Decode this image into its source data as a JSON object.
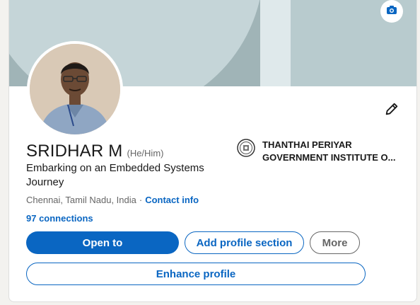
{
  "profile": {
    "name": "SRIDHAR M",
    "pronouns": "(He/Him)",
    "headline": "Embarking on an Embedded Systems Journey",
    "location": "Chennai, Tamil Nadu, India",
    "separator": "·",
    "contact_info": "Contact info",
    "connections": "97 connections"
  },
  "education": {
    "line1": "THANTHAI PERIYAR",
    "line2": "GOVERNMENT INSTITUTE O..."
  },
  "actions": {
    "open_to": "Open to",
    "add_section": "Add profile section",
    "more": "More",
    "enhance": "Enhance profile"
  },
  "icons": {
    "camera": "camera-icon",
    "edit": "pencil-icon",
    "school_logo": "school-seal-icon"
  },
  "colors": {
    "accent": "#0a66c2",
    "cover": "#a0b4b7",
    "text": "#191919",
    "muted": "#666666"
  }
}
